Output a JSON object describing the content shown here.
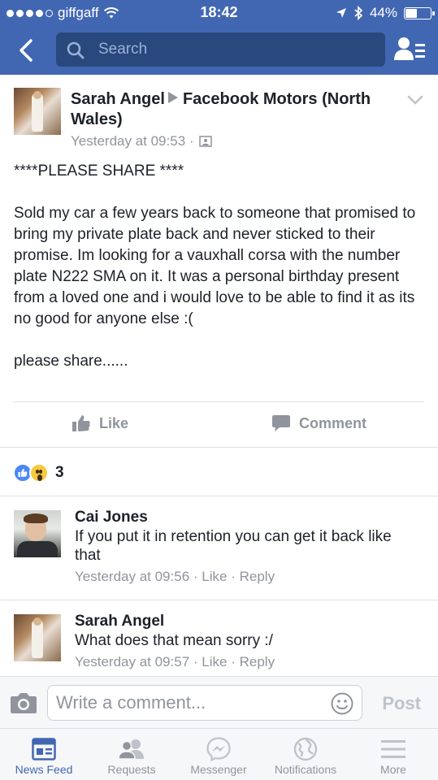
{
  "status_bar": {
    "carrier": "giffgaff",
    "time": "18:42",
    "battery": "44%",
    "signal_bars": 4
  },
  "header": {
    "search_placeholder": "Search"
  },
  "post": {
    "author": "Sarah Angel",
    "group": "Facebook Motors (North Wales)",
    "timestamp": "Yesterday at 09:53 ·",
    "text": "****PLEASE SHARE ****\n\nSold my car a few years back to someone that promised to bring my private plate back and never sticked to their promise. Im looking for a vauxhall corsa with the number plate N222 SMA on it. It was a personal birthday present from a loved one and i would love to be able to find it as its no good for anyone else :(\n\nplease share......",
    "actions": {
      "like": "Like",
      "comment": "Comment"
    },
    "reaction_count": "3"
  },
  "comments": [
    {
      "author": "Cai Jones",
      "text": "If you put it in retention you can get it back like that",
      "time": "Yesterday at 09:56",
      "like": "Like",
      "reply": "Reply",
      "sep": "·"
    },
    {
      "author": "Sarah Angel",
      "text": "What does that mean sorry :/",
      "time": "Yesterday at 09:57",
      "like": "Like",
      "reply": "Reply",
      "sep": "·"
    }
  ],
  "composer": {
    "placeholder": "Write a comment...",
    "post_label": "Post"
  },
  "tabs": [
    {
      "label": "News Feed",
      "icon": "news-feed-icon",
      "active": true
    },
    {
      "label": "Requests",
      "icon": "friend-requests-icon",
      "active": false
    },
    {
      "label": "Messenger",
      "icon": "messenger-icon",
      "active": false
    },
    {
      "label": "Notifications",
      "icon": "globe-icon",
      "active": false
    },
    {
      "label": "More",
      "icon": "hamburger-icon",
      "active": false
    }
  ],
  "colors": {
    "brand_blue": "#4267b2",
    "search_bg": "#29487d",
    "muted_text": "#90949c",
    "like_blue": "#4d88f5",
    "wow_yellow": "#f7c93f"
  }
}
